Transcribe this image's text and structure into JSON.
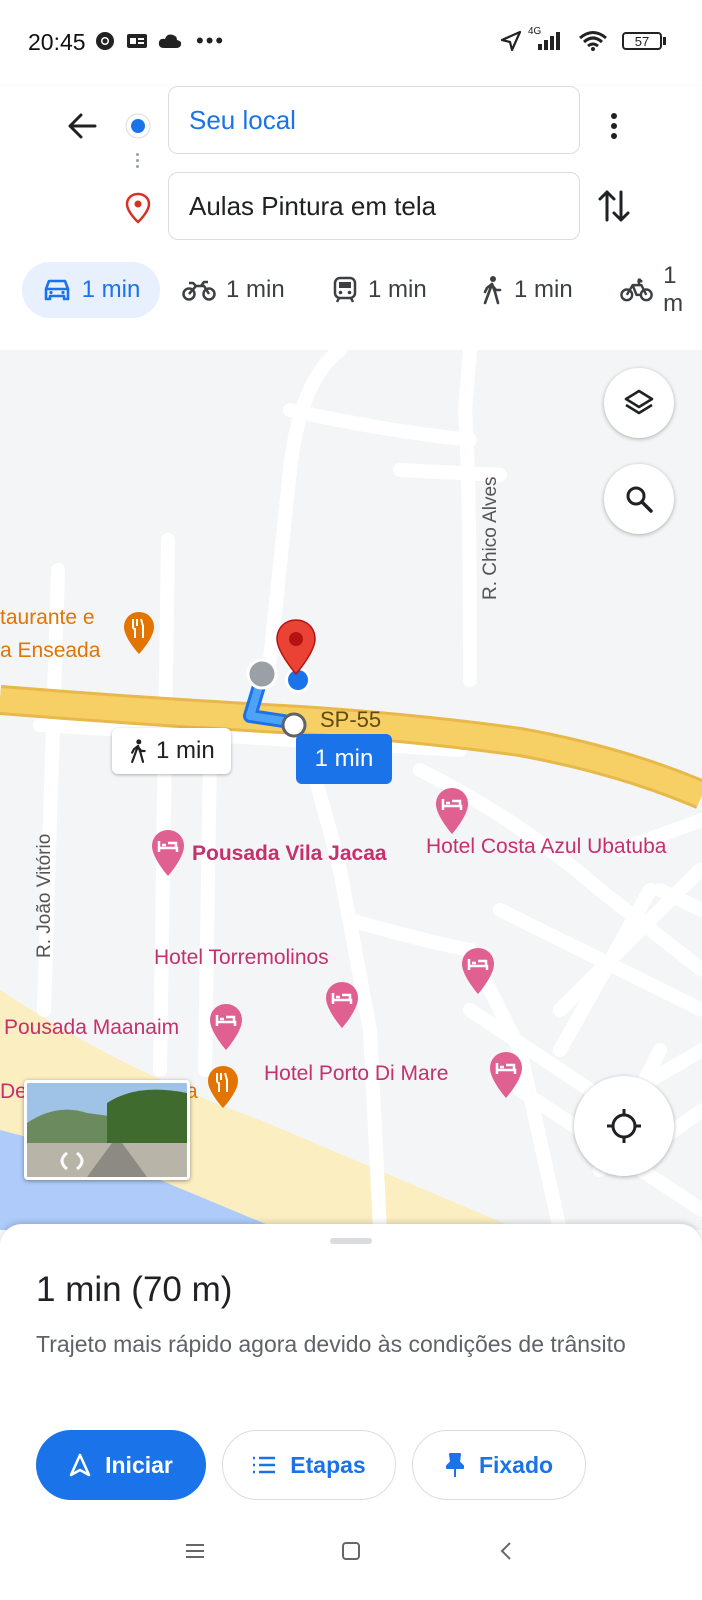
{
  "status_bar": {
    "time": "20:45",
    "network": "4G",
    "battery": "57"
  },
  "directions": {
    "origin": "Seu local",
    "destination": "Aulas Pintura em tela",
    "modes": [
      {
        "name": "car",
        "time": "1 min",
        "selected": true
      },
      {
        "name": "motorcycle",
        "time": "1 min"
      },
      {
        "name": "transit",
        "time": "1 min"
      },
      {
        "name": "walk",
        "time": "1 min"
      },
      {
        "name": "bike",
        "time": "1 m"
      }
    ]
  },
  "map": {
    "labels": {
      "restaurant_1": "taurante e",
      "restaurant_2": "a Enseada",
      "road_sp": "SP-55",
      "road_chico": "R. Chico Alves",
      "road_joao": "R. João Vitório",
      "walk_time": "1 min",
      "drive_time": "1 min",
      "pousada_vila": "Pousada Vila Jacaa",
      "hotel_costa": "Hotel Costa Azul Ubatuba",
      "hotel_torre": "Hotel Torremolinos",
      "pousada_maanaim": "Pousada Maanaim",
      "hotel_porto": "Hotel Porto Di Mare",
      "dei": "Dei",
      "a": "a"
    }
  },
  "sheet": {
    "summary": "1 min (70 m)",
    "description": "Trajeto mais rápido agora devido às condições de trânsito",
    "start_label": "Iniciar",
    "steps_label": "Etapas",
    "pinned_label": "Fixado"
  },
  "colors": {
    "accent": "#1a73e8",
    "poi": "#c5306d",
    "road_main": "#f6cf65",
    "water": "#aecbfa",
    "beach": "#fbeec1"
  }
}
